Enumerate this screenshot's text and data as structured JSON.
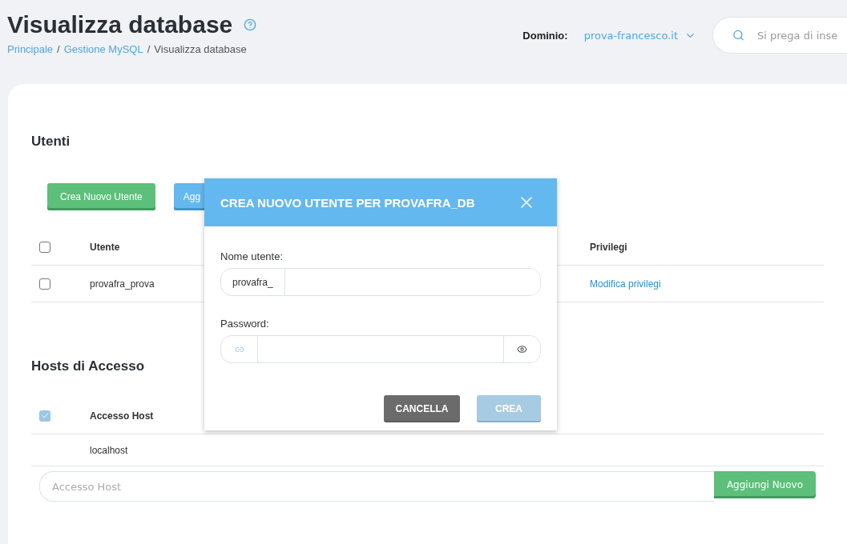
{
  "header": {
    "title": "Visualizza database",
    "breadcrumb": [
      {
        "label": "Principale",
        "link": true
      },
      {
        "separator": "/",
        "label": "Gestione MySQL",
        "link": true
      },
      {
        "separator": "/",
        "label": "Visualizza database",
        "link": false
      }
    ],
    "domain_label": "Dominio:",
    "domain_value": "prova-francesco.it",
    "search": {
      "placeholder": "Si prega di inse"
    }
  },
  "users": {
    "title": "Utenti",
    "buttons": [
      {
        "label": "Crea Nuovo Utente",
        "kind": "green"
      },
      {
        "label": "Agg",
        "kind": "blue"
      }
    ],
    "columns": [
      {
        "label": "Utente"
      },
      {
        "label": "Privilegi"
      }
    ],
    "select_all": {
      "checked": false
    },
    "rows": [
      {
        "checked": false,
        "user": "provafra_prova",
        "privileges": "Modifica privilegi"
      }
    ]
  },
  "hosts": {
    "title": "Hosts di Accesso",
    "select_all": {
      "checked": true
    },
    "column": "Accesso Host",
    "rows": [
      {
        "host": "localhost"
      }
    ],
    "input": {
      "placeholder": "Accesso Host"
    },
    "add_button": "Aggiungi Nuovo"
  },
  "modal": {
    "title": "CREA NUOVO UTENTE PER PROVAFRA_DB",
    "username_label": "Nome utente:",
    "username_prefix": "provafra_",
    "password_label": "Password:",
    "buttons": [
      {
        "label": "CANCELLA",
        "kind": "cancel",
        "disabled": false
      },
      {
        "label": "CREA",
        "kind": "primary",
        "disabled": true
      }
    ]
  }
}
